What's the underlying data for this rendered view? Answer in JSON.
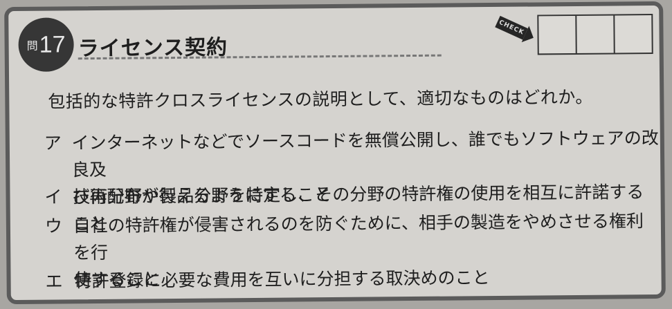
{
  "header": {
    "question_prefix": "問",
    "question_number": "17",
    "title": "ライセンス契約",
    "check_label": "CHECK"
  },
  "question": "包括的な特許クロスライセンスの説明として、適切なものはどれか。",
  "options": [
    {
      "label": "ア",
      "lines": [
        "インターネットなどでソースコードを無償公開し、誰でもソフトウェアの改良及",
        "び再配布が行えるようにすること"
      ]
    },
    {
      "label": "イ",
      "lines": [
        "技術分野や製品分野を特定し、その分野の特許権の使用を相互に許諾すること"
      ]
    },
    {
      "label": "ウ",
      "lines": [
        "自社の特許権が侵害されるのを防ぐために、相手の製造をやめさせる権利を行",
        "使すること"
      ]
    },
    {
      "label": "エ",
      "lines": [
        "特許登録に必要な費用を互いに分担する取決めのこと"
      ]
    }
  ]
}
